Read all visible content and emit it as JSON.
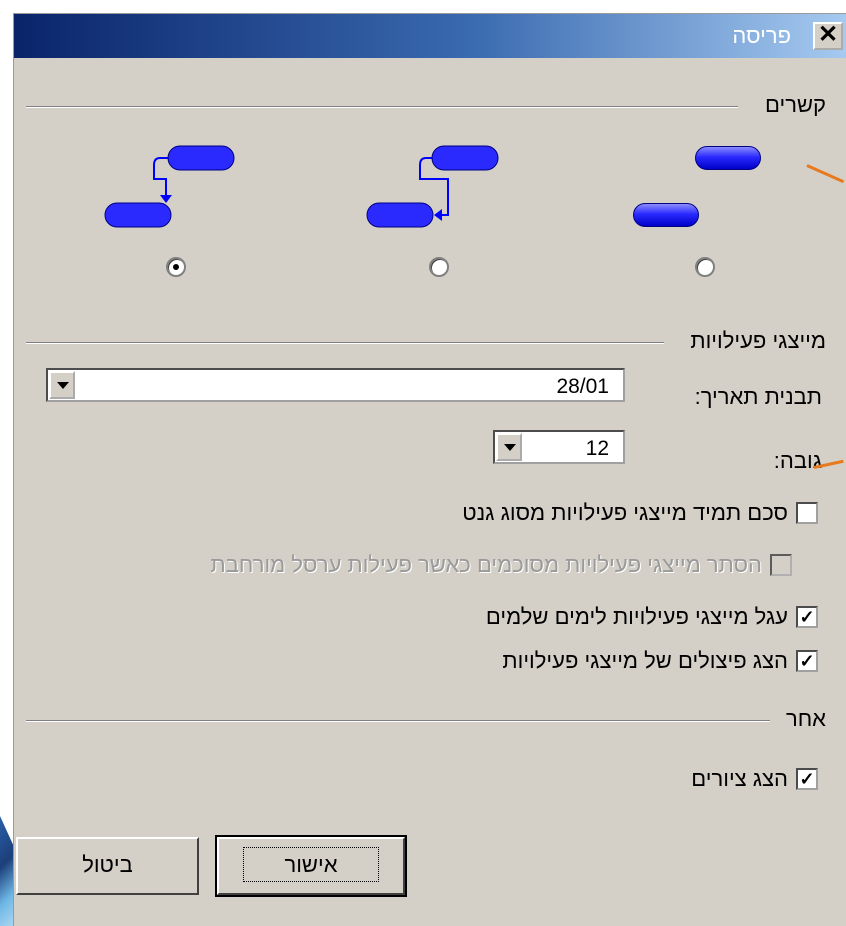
{
  "window": {
    "title": "פריסה"
  },
  "close_icon": "close-icon",
  "sections": {
    "links": {
      "label": "קשרים"
    },
    "task_bars": {
      "label": "מייצגי פעילויות"
    },
    "other": {
      "label": "אחר"
    }
  },
  "link_options": [
    {
      "style": "no-links",
      "selected": false
    },
    {
      "style": "side-links",
      "selected": false
    },
    {
      "style": "top-links",
      "selected": true
    }
  ],
  "date_format": {
    "label": "תבנית תאריך:",
    "value": "28/01"
  },
  "height": {
    "label": "גובה:",
    "value": "12"
  },
  "checkboxes": [
    {
      "label": "סכם תמיד מייצגי פעילויות מסוג גנט",
      "checked": false,
      "enabled": true
    },
    {
      "label": "הסתר מייצגי פעילויות מסוכמים כאשר פעילות ערסל מורחבת",
      "checked": false,
      "enabled": false
    },
    {
      "label": "עגל מייצגי פעילויות לימים שלמים",
      "checked": true,
      "enabled": true
    },
    {
      "label": "הצג פיצולים של מייצגי פעילויות",
      "checked": true,
      "enabled": true
    }
  ],
  "other_checkbox": {
    "label": "הצג ציורים",
    "checked": true
  },
  "buttons": {
    "ok": "אישור",
    "cancel": "ביטול"
  },
  "colors": {
    "title_start": "#0a246a",
    "title_end": "#a6caf0",
    "bar": "#0000c8",
    "face": "#d4d0c8",
    "accent": "#e87a1e"
  }
}
